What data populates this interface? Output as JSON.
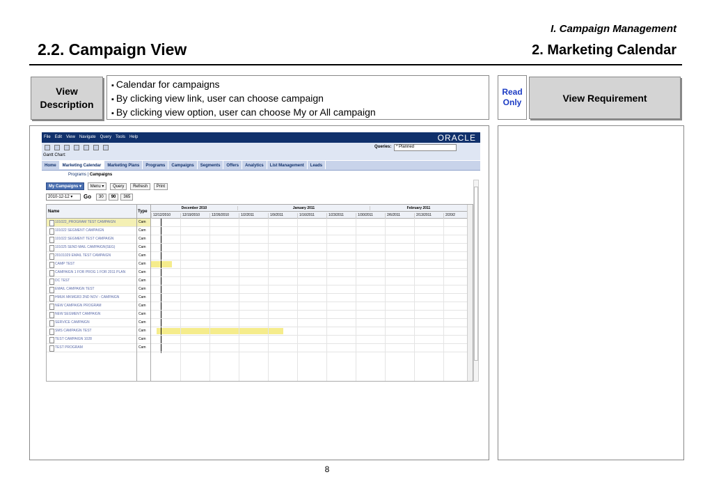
{
  "header": {
    "section": "I. Campaign Management",
    "title": "2.2. Campaign View",
    "subsection": "2. Marketing Calendar"
  },
  "view_description": {
    "label_line1": "View",
    "label_line2": "Description",
    "items": [
      "Calendar for campaigns",
      "By clicking view link, user can choose campaign",
      "By clicking view option, user can choose My or All campaign"
    ]
  },
  "access": {
    "line1": "Read",
    "line2": "Only"
  },
  "requirement_label": "View Requirement",
  "page_number": "8",
  "app": {
    "menu": [
      "File",
      "Edit",
      "View",
      "Navigate",
      "Query",
      "Tools",
      "Help"
    ],
    "brand": "ORACLE",
    "queries_label": "Queries:",
    "queries_value": "* Planned",
    "gantt_label": "Gantt Chart:",
    "tabs": [
      "Home",
      "Marketing Calendar",
      "Marketing Plans",
      "Programs",
      "Campaigns",
      "Segments",
      "Offers",
      "Analytics",
      "List Management",
      "Leads"
    ],
    "subtab_programs": "Programs",
    "subtab_campaigns": "Campaigns",
    "my_campaigns": "My Campaigns",
    "menu_btn": "Menu",
    "query_btn": "Query",
    "refresh_btn": "Refresh",
    "print_btn": "Print",
    "date_value": "2010-12-12",
    "go_btn": "Go",
    "nav_30": "30",
    "nav_90": "90",
    "nav_365": "365",
    "col_name": "Name",
    "col_type": "Type",
    "months": [
      "December 2010",
      "January 2011",
      "February 2011"
    ],
    "weeks": [
      "12/12/2010",
      "12/19/2010",
      "12/26/2010",
      "1/2/2011",
      "1/9/2011",
      "1/16/2011",
      "1/23/2011",
      "1/30/2011",
      "2/6/2011",
      "2/13/2011",
      "2/20/2"
    ],
    "type_abbr": "Cam",
    "campaigns": [
      "101022_PROGRAM TEST CAMPAIGN",
      "101022 SEGMENT CAMPAIGN",
      "101022 SEGMENT TEST CAMPAIGN",
      "101025 SEND MAIL CAMPAIGN(SEG)",
      "20101029 EMAIL TEST CAMPAIGN",
      "CAMP TEST",
      "CAMPAIGN 1 FOR PROG 1 FOR 2011 PLAN",
      "DC TEST",
      "EMAIL CAMPAIGN TEST",
      "HMUK MKMGR3 2ND NOV - CAMPAIGN",
      "NEW CAMPAIGN PROGRAM",
      "NEW SEGMENT CAMPAIGN",
      "SERVICE CAMPAIGN",
      "SMS CAMPAIGN TEST",
      "TEST CAMPAIGN 1028",
      "TEST PROGRAM"
    ]
  }
}
